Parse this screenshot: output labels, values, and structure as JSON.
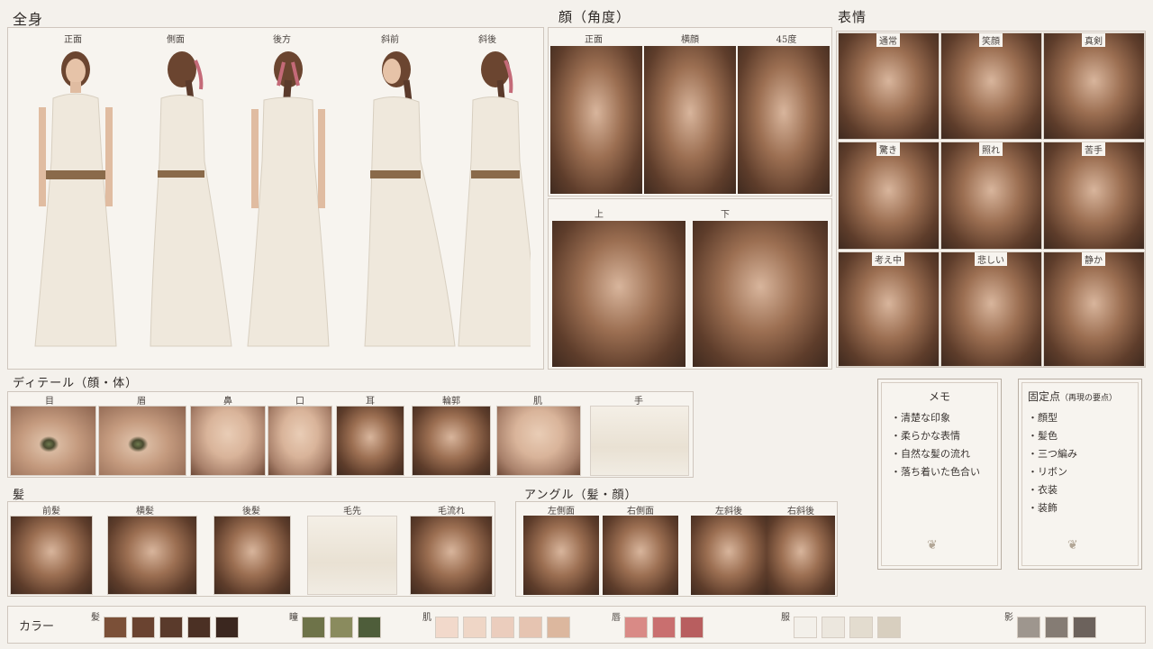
{
  "full_body": {
    "title": "全身",
    "captions": [
      "正面",
      "側面",
      "後方",
      "斜前",
      "斜後"
    ]
  },
  "face_angle": {
    "title": "顔（角度）",
    "captions_top": [
      "正面",
      "横顔",
      "45度"
    ],
    "captions_bottom": [
      "上",
      "下"
    ]
  },
  "expression": {
    "title": "表情",
    "captions": [
      "通常",
      "笑顔",
      "真剣",
      "驚き",
      "照れ",
      "苦手",
      "考え中",
      "悲しい",
      "静か"
    ]
  },
  "detail": {
    "title": "ディテール（顔・体）",
    "captions": [
      "目",
      "眉",
      "鼻",
      "口",
      "耳",
      "輪郭",
      "肌",
      "手"
    ]
  },
  "hair": {
    "title": "髪",
    "captions": [
      "前髪",
      "横髪",
      "後髪",
      "毛先",
      "毛流れ"
    ]
  },
  "angle": {
    "title": "アングル（髪・顔）",
    "captions": [
      "左側面",
      "右側面",
      "左斜後",
      "右斜後"
    ]
  },
  "memo": {
    "title": "メモ",
    "items": [
      "・清楚な印象",
      "・柔らかな表情",
      "・自然な髪の流れ",
      "・落ち着いた色合い"
    ]
  },
  "fixed": {
    "title": "固定点",
    "subtitle": "（再現の要点）",
    "items": [
      "・顔型",
      "・髪色",
      "・三つ編み",
      "・リボン",
      "・衣装",
      "・装飾"
    ]
  },
  "colors": {
    "title": "カラー",
    "groups": [
      {
        "label": "髪",
        "swatches": [
          "#7b5038",
          "#6a4330",
          "#5a3a2b",
          "#4b3024",
          "#3b271f"
        ]
      },
      {
        "label": "瞳",
        "swatches": [
          "#6e7349",
          "#8a8b5e",
          "#4e5d3a"
        ]
      },
      {
        "label": "肌",
        "swatches": [
          "#f2d9cb",
          "#efd6c6",
          "#ebcdbd",
          "#e6c4b1",
          "#dcb79e"
        ]
      },
      {
        "label": "唇",
        "swatches": [
          "#d98a86",
          "#c96f6f",
          "#b85e5f"
        ]
      },
      {
        "label": "服",
        "swatches": [
          "#f3f0ea",
          "#ece7de",
          "#e3dccf",
          "#d8cfbf"
        ]
      },
      {
        "label": "影",
        "swatches": [
          "#9e968e",
          "#857c74",
          "#6c625c"
        ]
      }
    ]
  }
}
